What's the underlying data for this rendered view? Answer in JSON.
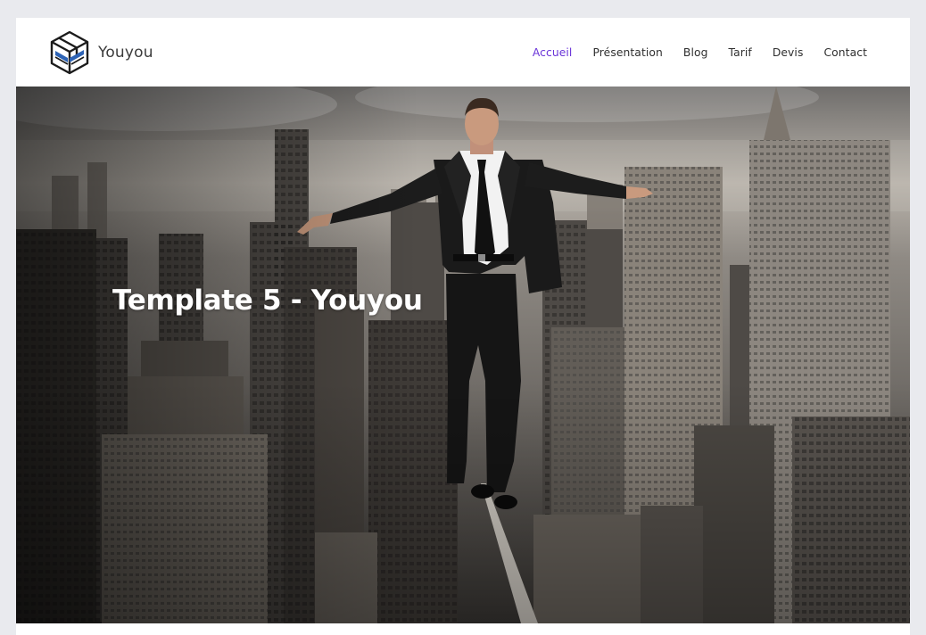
{
  "brand": {
    "name": "Youyou",
    "logo_icon": "box-logo-icon"
  },
  "nav": {
    "items": [
      {
        "label": "Accueil",
        "active": true
      },
      {
        "label": "Présentation",
        "active": false
      },
      {
        "label": "Blog",
        "active": false
      },
      {
        "label": "Tarif",
        "active": false
      },
      {
        "label": "Devis",
        "active": false
      },
      {
        "label": "Contact",
        "active": false
      }
    ]
  },
  "hero": {
    "title": "Template 5 - Youyou",
    "image": "businessman-tightrope-city-photo"
  },
  "colors": {
    "accent": "#6a34d8",
    "text": "#2f2f2f",
    "background": "#e9eaee"
  }
}
